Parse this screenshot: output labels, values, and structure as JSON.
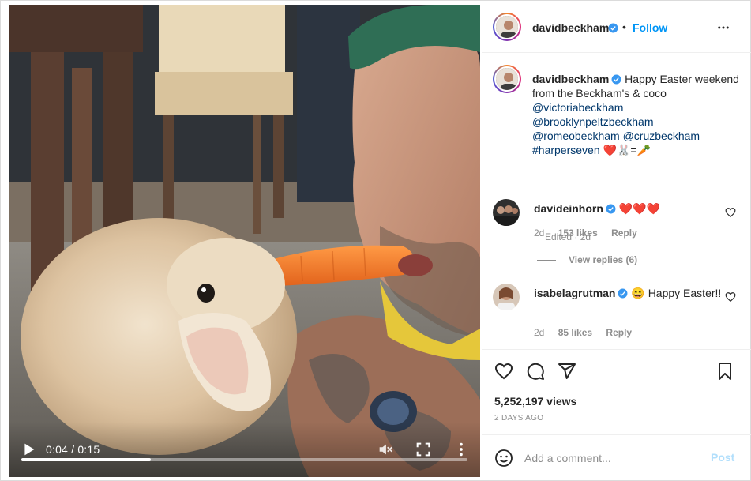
{
  "colors": {
    "accent": "#0095f6",
    "mention": "#00376b",
    "muted": "#8e8e8e",
    "post_disabled": "#b2dffc"
  },
  "video": {
    "current_time": "0:04",
    "duration": "0:15",
    "time_display": "0:04 / 0:15",
    "progress_fraction": 0.29,
    "muted": true,
    "icons": [
      "play-icon",
      "mute-icon",
      "fullscreen-icon",
      "more-vertical-icon"
    ]
  },
  "header": {
    "username": "davidbeckham",
    "verified": true,
    "separator": "•",
    "follow_label": "Follow",
    "options_icon": "more-horizontal-icon"
  },
  "caption": {
    "username": "davidbeckham",
    "text": "Happy Easter weekend from the Beckham's & coco",
    "mentions": [
      "@victoriabeckham",
      "@brooklynpeltzbeckham",
      "@romeobeckham",
      "@cruzbeckham"
    ],
    "hashtag": "#harperseven",
    "emojis": "❤️🐰=🥕",
    "edited": "Edited · 2d"
  },
  "comments": [
    {
      "username": "davideinhorn",
      "verified": true,
      "text": "❤️❤️❤️",
      "age": "2d",
      "likes": "153 likes",
      "reply_label": "Reply",
      "view_replies": "View replies (6)"
    },
    {
      "username": "isabelagrutman",
      "verified": true,
      "text": "😄 Happy Easter!!",
      "age": "2d",
      "likes": "85 likes",
      "reply_label": "Reply"
    }
  ],
  "actions": {
    "icons": [
      "heart-icon",
      "comment-icon",
      "share-icon",
      "bookmark-icon"
    ],
    "views": "5,252,197 views",
    "time_ago": "2 DAYS AGO"
  },
  "composer": {
    "placeholder": "Add a comment...",
    "post_label": "Post",
    "emoji_icon": "emoji-icon"
  }
}
